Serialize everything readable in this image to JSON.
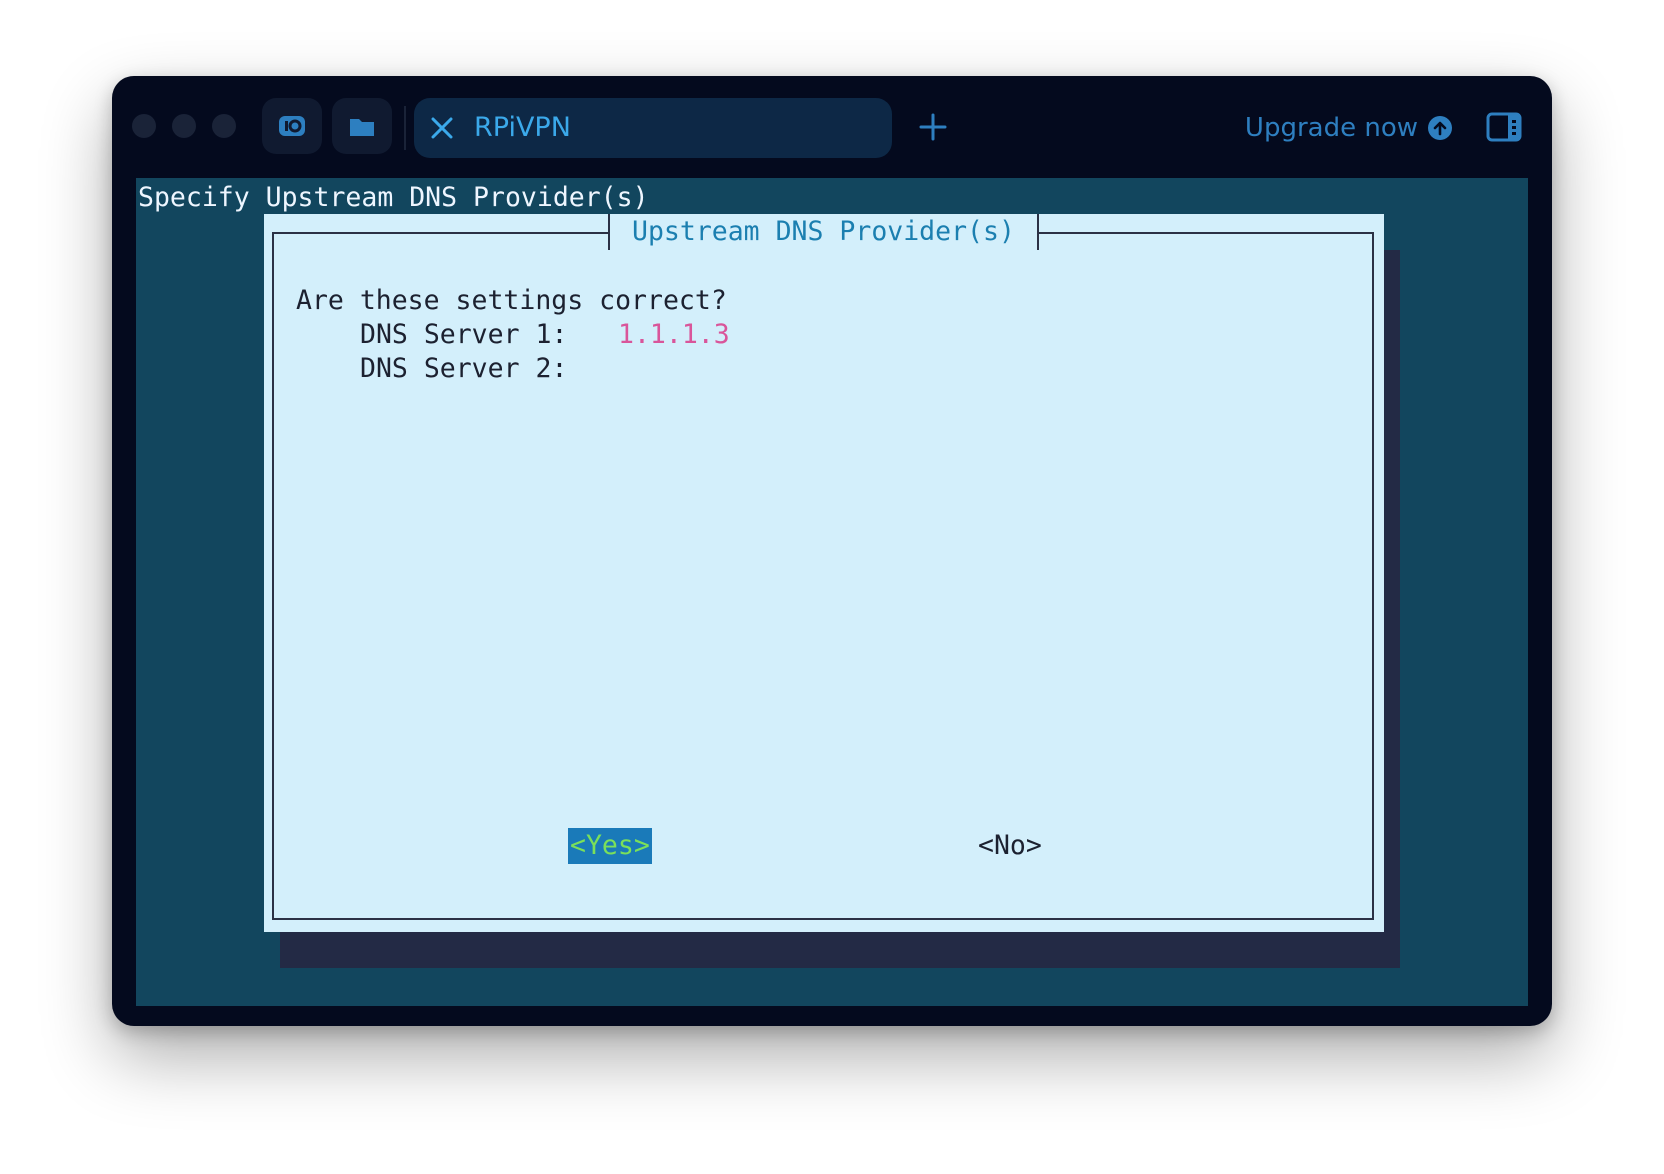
{
  "window": {
    "controls": [
      "close",
      "minimize",
      "zoom"
    ]
  },
  "toolbar": {
    "snippets_icon": "snippets-icon",
    "folder_icon": "folder-icon",
    "tab": {
      "title": "RPiVPN",
      "close_icon": "close-icon"
    },
    "new_tab_icon": "plus-icon",
    "upgrade_label": "Upgrade now",
    "upgrade_icon": "arrow-up-circle-icon",
    "panel_icon": "sidebar-toggle-icon"
  },
  "terminal": {
    "background_title": "Specify Upstream DNS Provider(s)",
    "dialog": {
      "title": "Upstream DNS Provider(s)",
      "question": "Are these settings correct?",
      "dns1_label": "DNS Server 1:",
      "dns1_value": "1.1.1.3",
      "dns2_label": "DNS Server 2:",
      "dns2_value": "",
      "yes_label": "<Yes>",
      "no_label": "<No>"
    }
  },
  "colors": {
    "window_bg": "#040a1e",
    "terminal_bg": "#12465e",
    "dialog_bg": "#d3effb",
    "dialog_title": "#1b7fb0",
    "dns_value": "#d9559a",
    "yes_bg": "#1a7ab9",
    "yes_text": "#7be05a",
    "accent": "#3ba9ea"
  }
}
